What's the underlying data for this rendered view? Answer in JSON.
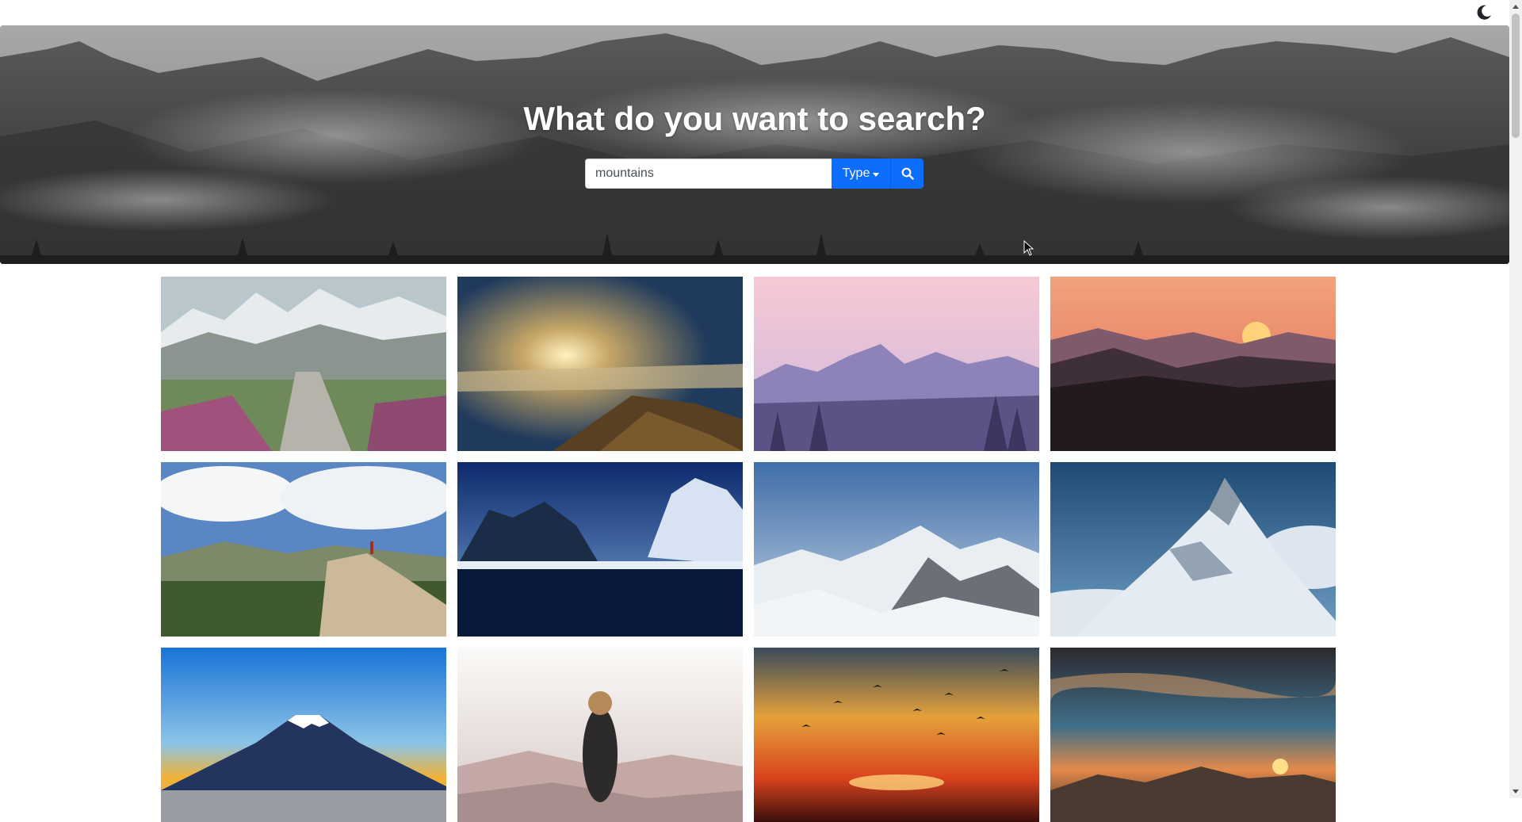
{
  "hero": {
    "title": "What do you want to search?"
  },
  "search": {
    "value": "mountains",
    "type_label": "Type"
  },
  "icons": {
    "theme_toggle": "moon-icon",
    "search": "search-icon",
    "dropdown": "caret-down-icon"
  },
  "colors": {
    "accent": "#0d6efd",
    "hero_bg": "#4a4a4a"
  },
  "gallery": {
    "images": [
      {
        "subject": "snowy mountains with stone path and heather"
      },
      {
        "subject": "sunrise over clouds from mountain ridge"
      },
      {
        "subject": "purple mountain silhouette with birds and pine trees"
      },
      {
        "subject": "orange sunset over layered mountain silhouettes"
      },
      {
        "subject": "hiker on cliff edge above green valley"
      },
      {
        "subject": "blue winter valley with lake and cliffs"
      },
      {
        "subject": "snowy alpine peaks under blue sky"
      },
      {
        "subject": "snow-covered mountain peak above clouds"
      },
      {
        "subject": "Mount Fuji at dawn"
      },
      {
        "subject": "woman sitting on rock overlooking hazy mountains"
      },
      {
        "subject": "red sunset with flying birds"
      },
      {
        "subject": "dramatic sunset clouds over rocky mountains"
      }
    ]
  }
}
